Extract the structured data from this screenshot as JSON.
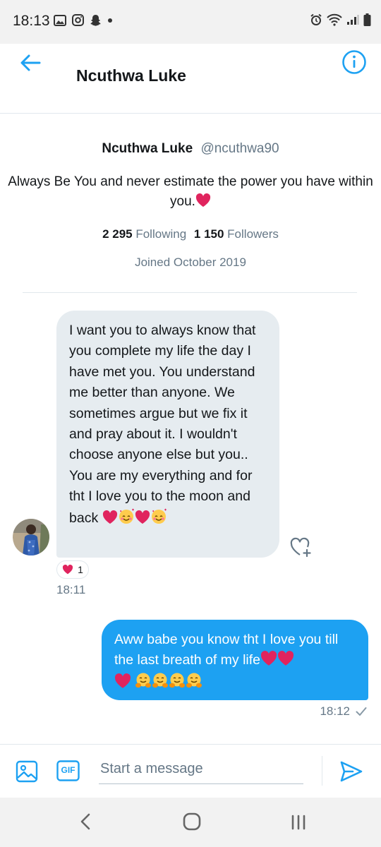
{
  "status_bar": {
    "time": "18:13"
  },
  "header": {
    "title": "Ncuthwa Luke"
  },
  "profile": {
    "name": "Ncuthwa Luke",
    "handle": "@ncuthwa90",
    "bio": "Always Be You and never estimate the power you have within you.",
    "following_count": "2 295",
    "following_label": "Following",
    "followers_count": "1 150",
    "followers_label": "Followers",
    "joined": "Joined October 2019"
  },
  "messages": [
    {
      "direction": "incoming",
      "text": "I want  you to always know that you complete my life the day I have met you. You understand me better than anyone. We sometimes argue but we fix it and pray about it. I wouldn't choose anyone else but you.. You are my everything and for tht I love you to the moon and back",
      "reaction_count": "1",
      "time": "18:11"
    },
    {
      "direction": "outgoing",
      "text": "Aww babe you know tht I love you till the last breath  of my life",
      "time": "18:12"
    }
  ],
  "composer": {
    "placeholder": "Start a message",
    "gif_label": "GIF"
  },
  "colors": {
    "accent": "#1da1f2",
    "incoming_bubble": "#e6ecf0",
    "heart": "#e0245e",
    "text": "#14171a",
    "muted": "#657786"
  },
  "icons": [
    "back-arrow-icon",
    "info-icon",
    "image-icon",
    "gif-icon",
    "send-icon",
    "heart-plus-icon",
    "heart-icon",
    "hugging-face-icon",
    "smiling-hearts-face-icon"
  ]
}
